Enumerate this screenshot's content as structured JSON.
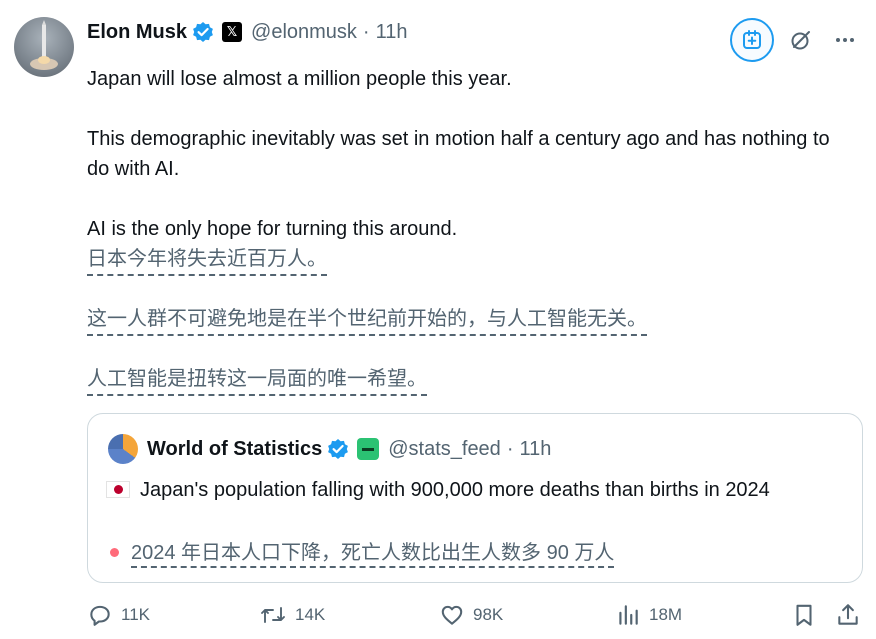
{
  "tweet": {
    "author_name": "Elon Musk",
    "affiliate_badge": "x-logo-icon",
    "handle": "@elonmusk",
    "separator": "·",
    "time": "11h",
    "text": [
      "Japan will lose almost a million people this year.",
      "This demographic inevitably was set in motion half a century ago and has nothing to do with AI.",
      "AI is the only hope for turning this around."
    ],
    "translation": [
      "日本今年将失去近百万人。",
      "这一人群不可避免地是在半个世纪前开始的，与人工智能无关。",
      "人工智能是扭转这一局面的唯一希望。"
    ]
  },
  "quote": {
    "author_name": "World of Statistics",
    "handle": "@stats_feed",
    "separator": "·",
    "time": "11h",
    "text": "Japan's population falling with 900,000 more deaths than births in 2024",
    "translation": "2024 年日本人口下降，死亡人数比出生人数多 90 万人"
  },
  "actions": {
    "replies": "11K",
    "reposts": "14K",
    "likes": "98K",
    "views": "18M"
  },
  "colors": {
    "verified_blue": "#1d9bf0",
    "secondary_text": "#536471",
    "border": "#cfd9de"
  }
}
